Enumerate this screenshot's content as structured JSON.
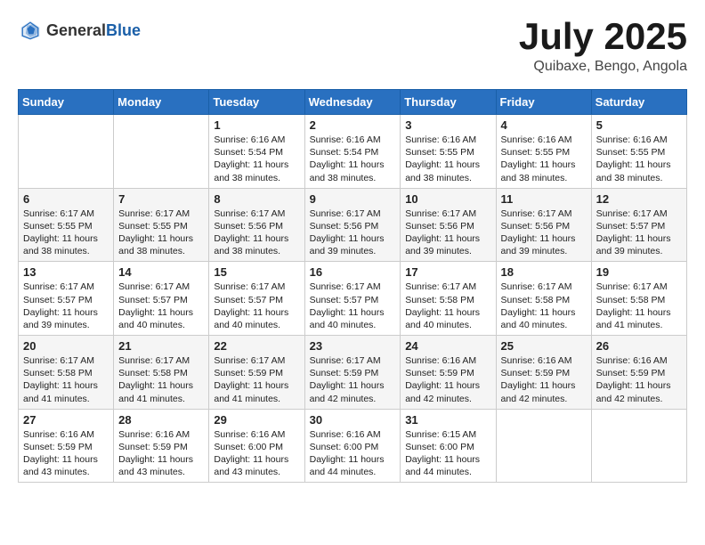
{
  "header": {
    "logo_general": "General",
    "logo_blue": "Blue",
    "month": "July 2025",
    "location": "Quibaxe, Bengo, Angola"
  },
  "weekdays": [
    "Sunday",
    "Monday",
    "Tuesday",
    "Wednesday",
    "Thursday",
    "Friday",
    "Saturday"
  ],
  "weeks": [
    [
      {
        "day": "",
        "content": ""
      },
      {
        "day": "",
        "content": ""
      },
      {
        "day": "1",
        "content": "Sunrise: 6:16 AM\nSunset: 5:54 PM\nDaylight: 11 hours and 38 minutes."
      },
      {
        "day": "2",
        "content": "Sunrise: 6:16 AM\nSunset: 5:54 PM\nDaylight: 11 hours and 38 minutes."
      },
      {
        "day": "3",
        "content": "Sunrise: 6:16 AM\nSunset: 5:55 PM\nDaylight: 11 hours and 38 minutes."
      },
      {
        "day": "4",
        "content": "Sunrise: 6:16 AM\nSunset: 5:55 PM\nDaylight: 11 hours and 38 minutes."
      },
      {
        "day": "5",
        "content": "Sunrise: 6:16 AM\nSunset: 5:55 PM\nDaylight: 11 hours and 38 minutes."
      }
    ],
    [
      {
        "day": "6",
        "content": "Sunrise: 6:17 AM\nSunset: 5:55 PM\nDaylight: 11 hours and 38 minutes."
      },
      {
        "day": "7",
        "content": "Sunrise: 6:17 AM\nSunset: 5:55 PM\nDaylight: 11 hours and 38 minutes."
      },
      {
        "day": "8",
        "content": "Sunrise: 6:17 AM\nSunset: 5:56 PM\nDaylight: 11 hours and 38 minutes."
      },
      {
        "day": "9",
        "content": "Sunrise: 6:17 AM\nSunset: 5:56 PM\nDaylight: 11 hours and 39 minutes."
      },
      {
        "day": "10",
        "content": "Sunrise: 6:17 AM\nSunset: 5:56 PM\nDaylight: 11 hours and 39 minutes."
      },
      {
        "day": "11",
        "content": "Sunrise: 6:17 AM\nSunset: 5:56 PM\nDaylight: 11 hours and 39 minutes."
      },
      {
        "day": "12",
        "content": "Sunrise: 6:17 AM\nSunset: 5:57 PM\nDaylight: 11 hours and 39 minutes."
      }
    ],
    [
      {
        "day": "13",
        "content": "Sunrise: 6:17 AM\nSunset: 5:57 PM\nDaylight: 11 hours and 39 minutes."
      },
      {
        "day": "14",
        "content": "Sunrise: 6:17 AM\nSunset: 5:57 PM\nDaylight: 11 hours and 40 minutes."
      },
      {
        "day": "15",
        "content": "Sunrise: 6:17 AM\nSunset: 5:57 PM\nDaylight: 11 hours and 40 minutes."
      },
      {
        "day": "16",
        "content": "Sunrise: 6:17 AM\nSunset: 5:57 PM\nDaylight: 11 hours and 40 minutes."
      },
      {
        "day": "17",
        "content": "Sunrise: 6:17 AM\nSunset: 5:58 PM\nDaylight: 11 hours and 40 minutes."
      },
      {
        "day": "18",
        "content": "Sunrise: 6:17 AM\nSunset: 5:58 PM\nDaylight: 11 hours and 40 minutes."
      },
      {
        "day": "19",
        "content": "Sunrise: 6:17 AM\nSunset: 5:58 PM\nDaylight: 11 hours and 41 minutes."
      }
    ],
    [
      {
        "day": "20",
        "content": "Sunrise: 6:17 AM\nSunset: 5:58 PM\nDaylight: 11 hours and 41 minutes."
      },
      {
        "day": "21",
        "content": "Sunrise: 6:17 AM\nSunset: 5:58 PM\nDaylight: 11 hours and 41 minutes."
      },
      {
        "day": "22",
        "content": "Sunrise: 6:17 AM\nSunset: 5:59 PM\nDaylight: 11 hours and 41 minutes."
      },
      {
        "day": "23",
        "content": "Sunrise: 6:17 AM\nSunset: 5:59 PM\nDaylight: 11 hours and 42 minutes."
      },
      {
        "day": "24",
        "content": "Sunrise: 6:16 AM\nSunset: 5:59 PM\nDaylight: 11 hours and 42 minutes."
      },
      {
        "day": "25",
        "content": "Sunrise: 6:16 AM\nSunset: 5:59 PM\nDaylight: 11 hours and 42 minutes."
      },
      {
        "day": "26",
        "content": "Sunrise: 6:16 AM\nSunset: 5:59 PM\nDaylight: 11 hours and 42 minutes."
      }
    ],
    [
      {
        "day": "27",
        "content": "Sunrise: 6:16 AM\nSunset: 5:59 PM\nDaylight: 11 hours and 43 minutes."
      },
      {
        "day": "28",
        "content": "Sunrise: 6:16 AM\nSunset: 5:59 PM\nDaylight: 11 hours and 43 minutes."
      },
      {
        "day": "29",
        "content": "Sunrise: 6:16 AM\nSunset: 6:00 PM\nDaylight: 11 hours and 43 minutes."
      },
      {
        "day": "30",
        "content": "Sunrise: 6:16 AM\nSunset: 6:00 PM\nDaylight: 11 hours and 44 minutes."
      },
      {
        "day": "31",
        "content": "Sunrise: 6:15 AM\nSunset: 6:00 PM\nDaylight: 11 hours and 44 minutes."
      },
      {
        "day": "",
        "content": ""
      },
      {
        "day": "",
        "content": ""
      }
    ]
  ]
}
